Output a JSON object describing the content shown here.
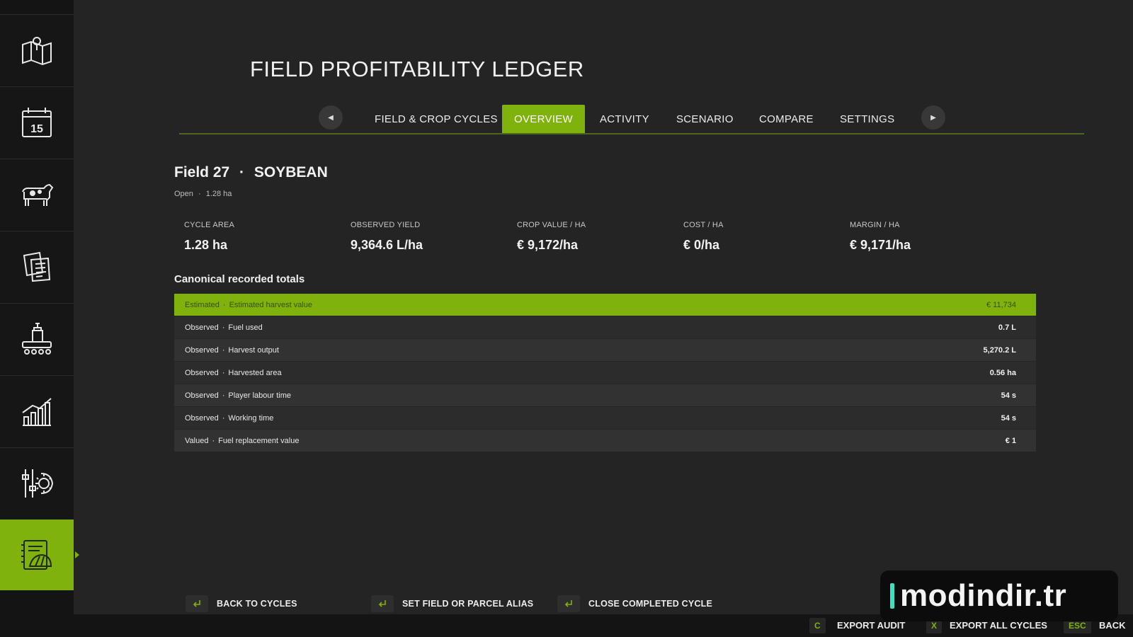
{
  "sidebar": {
    "items": [
      {
        "icon": "map-pin-icon"
      },
      {
        "icon": "calendar-icon",
        "day": "15"
      },
      {
        "icon": "cow-icon"
      },
      {
        "icon": "documents-icon"
      },
      {
        "icon": "production-icon"
      },
      {
        "icon": "statistics-icon"
      },
      {
        "icon": "settings-icon"
      },
      {
        "icon": "ledger-icon",
        "active": true
      }
    ]
  },
  "header": {
    "title": "FIELD PROFITABILITY LEDGER"
  },
  "tabs": [
    {
      "label": "FIELD & CROP CYCLES"
    },
    {
      "label": "OVERVIEW",
      "active": true
    },
    {
      "label": "ACTIVITY"
    },
    {
      "label": "SCENARIO"
    },
    {
      "label": "COMPARE"
    },
    {
      "label": "SETTINGS"
    }
  ],
  "field": {
    "name": "Field 27",
    "separator": "·",
    "crop": "SOYBEAN",
    "status": "Open",
    "area": "1.28 ha"
  },
  "metrics": [
    {
      "label": "CYCLE AREA",
      "value": "1.28 ha"
    },
    {
      "label": "OBSERVED YIELD",
      "value": "9,364.6 L/ha"
    },
    {
      "label": "CROP VALUE / HA",
      "value": "€ 9,172/ha"
    },
    {
      "label": "COST / HA",
      "value": "€ 0/ha"
    },
    {
      "label": "MARGIN / HA",
      "value": "€ 9,171/ha"
    }
  ],
  "totals": {
    "title": "Canonical recorded totals",
    "rows": [
      {
        "kind": "Estimated",
        "name": "Estimated harvest value",
        "value": "€ 11,734",
        "highlight": true
      },
      {
        "kind": "Observed",
        "name": "Fuel used",
        "value": "0.7 L"
      },
      {
        "kind": "Observed",
        "name": "Harvest output",
        "value": "5,270.2 L"
      },
      {
        "kind": "Observed",
        "name": "Harvested area",
        "value": "0.56 ha"
      },
      {
        "kind": "Observed",
        "name": "Player labour time",
        "value": "54 s"
      },
      {
        "kind": "Observed",
        "name": "Working time",
        "value": "54 s"
      },
      {
        "kind": "Valued",
        "name": "Fuel replacement value",
        "value": "€ 1"
      }
    ]
  },
  "actions": [
    {
      "label": "BACK TO CYCLES"
    },
    {
      "label": "SET FIELD OR PARCEL ALIAS"
    },
    {
      "label": "CLOSE COMPLETED CYCLE"
    }
  ],
  "footer": {
    "items": [
      {
        "key": "C",
        "label": "EXPORT AUDIT"
      },
      {
        "key": "X",
        "label": "EXPORT ALL CYCLES"
      },
      {
        "key": "ESC",
        "label": "BACK"
      }
    ]
  },
  "watermark": {
    "text": "modindir.tr"
  },
  "colors": {
    "accent": "#7fb20d",
    "background": "#242424",
    "sidebar": "#141414"
  }
}
